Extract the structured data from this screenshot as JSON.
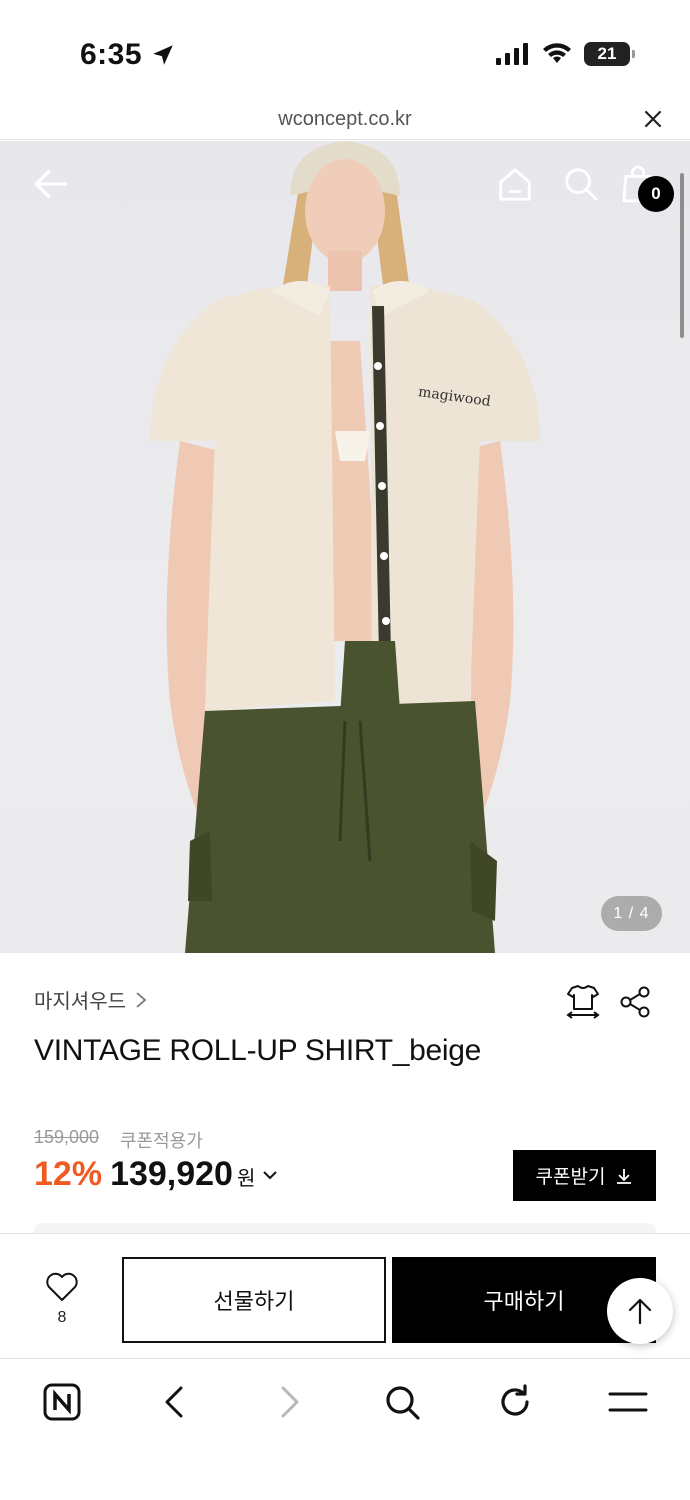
{
  "status_bar": {
    "time": "6:35",
    "battery": "21"
  },
  "url_bar": {
    "url": "wconcept.co.kr"
  },
  "hero": {
    "cart_count": "0",
    "page_indicator": "1 / 4"
  },
  "product": {
    "brand": "마지셔우드",
    "title": "VINTAGE ROLL-UP SHIRT_beige",
    "original_price": "159,000",
    "coupon_label": "쿠폰적용가",
    "discount": "12%",
    "sale_price": "139,920",
    "currency": "원",
    "coupon_button": "쿠폰받기"
  },
  "action_bar": {
    "like_count": "8",
    "gift_label": "선물하기",
    "buy_label": "구매하기"
  },
  "colors": {
    "accent_discount": "#f05a23",
    "primary_black": "#000000"
  },
  "icons": {
    "hero": [
      "back-arrow-icon",
      "home-icon",
      "search-icon",
      "shopping-bag-icon"
    ],
    "product": [
      "fit-guide-icon",
      "share-icon"
    ],
    "browser": [
      "naver-icon",
      "back-icon",
      "forward-icon",
      "search-icon",
      "refresh-icon",
      "menu-icon"
    ]
  }
}
